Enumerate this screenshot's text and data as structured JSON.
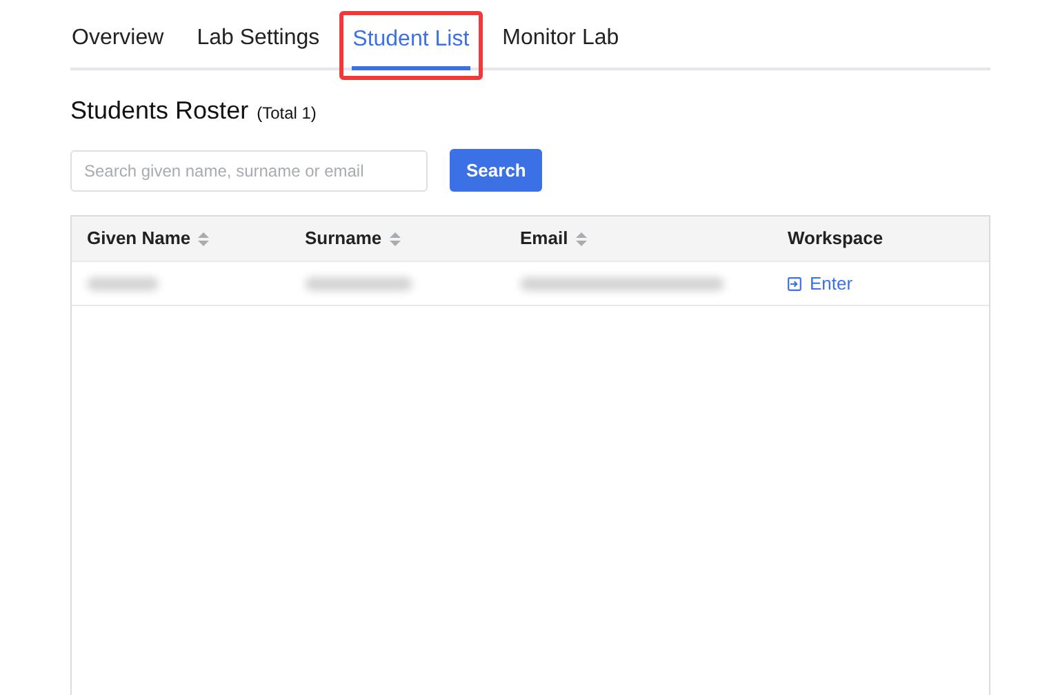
{
  "tabs": [
    {
      "label": "Overview",
      "selected": false,
      "highlighted": false
    },
    {
      "label": "Lab Settings",
      "selected": false,
      "highlighted": false
    },
    {
      "label": "Student List",
      "selected": true,
      "highlighted": true
    },
    {
      "label": "Monitor Lab",
      "selected": false,
      "highlighted": false
    }
  ],
  "heading": {
    "title": "Students Roster",
    "count": "(Total 1)"
  },
  "search": {
    "placeholder": "Search given name, surname or email",
    "button": "Search"
  },
  "table": {
    "columns": [
      {
        "label": "Given Name",
        "sortable": true
      },
      {
        "label": "Surname",
        "sortable": true
      },
      {
        "label": "Email",
        "sortable": true
      },
      {
        "label": "Workspace",
        "sortable": false
      }
    ],
    "rows": [
      {
        "cells": [
          {
            "kind": "redacted"
          },
          {
            "kind": "redacted"
          },
          {
            "kind": "redacted"
          },
          {
            "kind": "link",
            "text": "Enter"
          }
        ]
      }
    ]
  }
}
